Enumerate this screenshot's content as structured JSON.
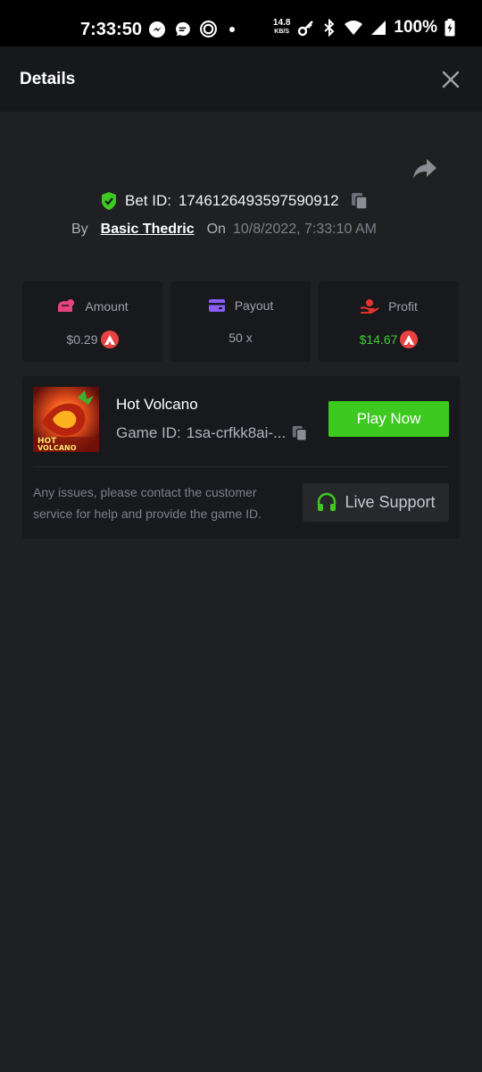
{
  "status_bar": {
    "time": "7:33:50",
    "speed_value": "14.8",
    "speed_unit": "KB/S",
    "battery": "100%"
  },
  "header": {
    "title": "Details"
  },
  "bet": {
    "id_label": "Bet ID:",
    "id_value": "1746126493597590912",
    "by_label": "By",
    "user": "Basic Thedric",
    "on_label": "On",
    "date": "10/8/2022, 7:33:10 AM"
  },
  "stats": {
    "amount": {
      "label": "Amount",
      "value": "$0.29"
    },
    "payout": {
      "label": "Payout",
      "value": "50 x"
    },
    "profit": {
      "label": "Profit",
      "value": "$14.67"
    }
  },
  "game": {
    "name": "Hot Volcano",
    "thumb_line1": "HOT",
    "thumb_line2": "VOLCANO",
    "id_label": "Game ID:",
    "id_value": "1sa-crfkk8ai-...",
    "play_label": "Play Now"
  },
  "support": {
    "help_text": "Any issues, please contact the customer service for help and provide the game ID.",
    "button_label": "Live Support"
  },
  "colors": {
    "accent_green": "#3dc91f",
    "profit_green": "#45cb3a",
    "avax_red": "#e84142"
  }
}
